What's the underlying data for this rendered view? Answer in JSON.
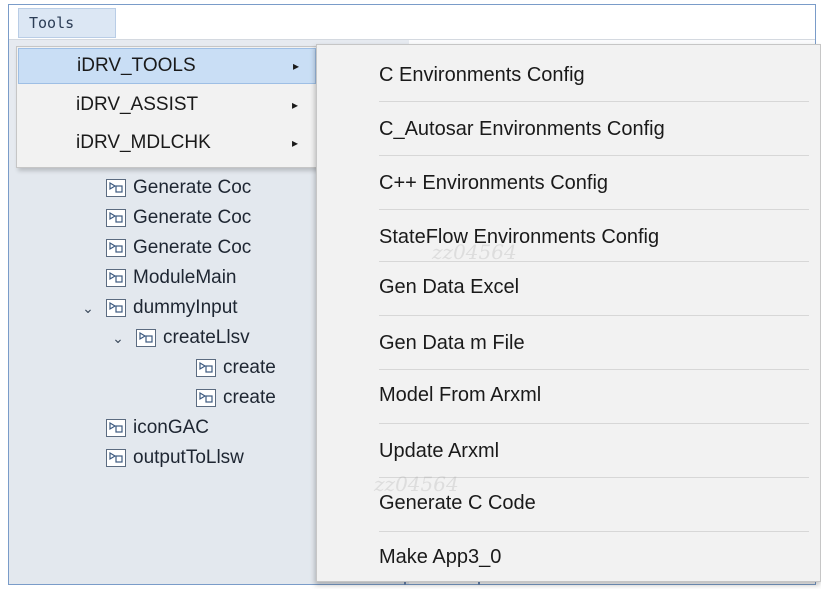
{
  "menubar": {
    "tools_label": "Tools"
  },
  "left_menu": {
    "items": [
      {
        "label": "iDRV_TOOLS",
        "arrow": "▸",
        "active": true
      },
      {
        "label": "iDRV_ASSIST",
        "arrow": "▸",
        "active": false
      },
      {
        "label": "iDRV_MDLCHK",
        "arrow": "▸",
        "active": false
      }
    ]
  },
  "tree": {
    "items": [
      {
        "label": "Generate Coc",
        "chevron": ""
      },
      {
        "label": "Generate Coc",
        "chevron": ""
      },
      {
        "label": "Generate Coc",
        "chevron": ""
      },
      {
        "label": "ModuleMain",
        "chevron": ""
      },
      {
        "label": "dummyInput",
        "chevron": "⌄"
      },
      {
        "label": "createLlsv",
        "chevron": "⌄"
      },
      {
        "label": "create",
        "chevron": ""
      },
      {
        "label": "create",
        "chevron": ""
      },
      {
        "label": "iconGAC",
        "chevron": ""
      },
      {
        "label": "outputToLlsw",
        "chevron": ""
      }
    ]
  },
  "submenu": {
    "items": [
      {
        "label": "C Environments Config"
      },
      {
        "label": "C_Autosar Environments Config"
      },
      {
        "label": "C++ Environments Config"
      },
      {
        "label": "StateFlow Environments Config"
      },
      {
        "label": "Gen Data Excel"
      },
      {
        "label": "Gen Data m  File"
      },
      {
        "label": "Model From Arxml"
      },
      {
        "label": "Update Arxml"
      },
      {
        "label": "Generate C Code"
      },
      {
        "label": "Make App3_0"
      }
    ]
  },
  "watermarks": [
    "zz04564",
    "zz04564"
  ],
  "colors": {
    "active_item_bg": "#c9def5",
    "menu_bg": "#f2f2f2",
    "window_border": "#7a9cc9"
  }
}
